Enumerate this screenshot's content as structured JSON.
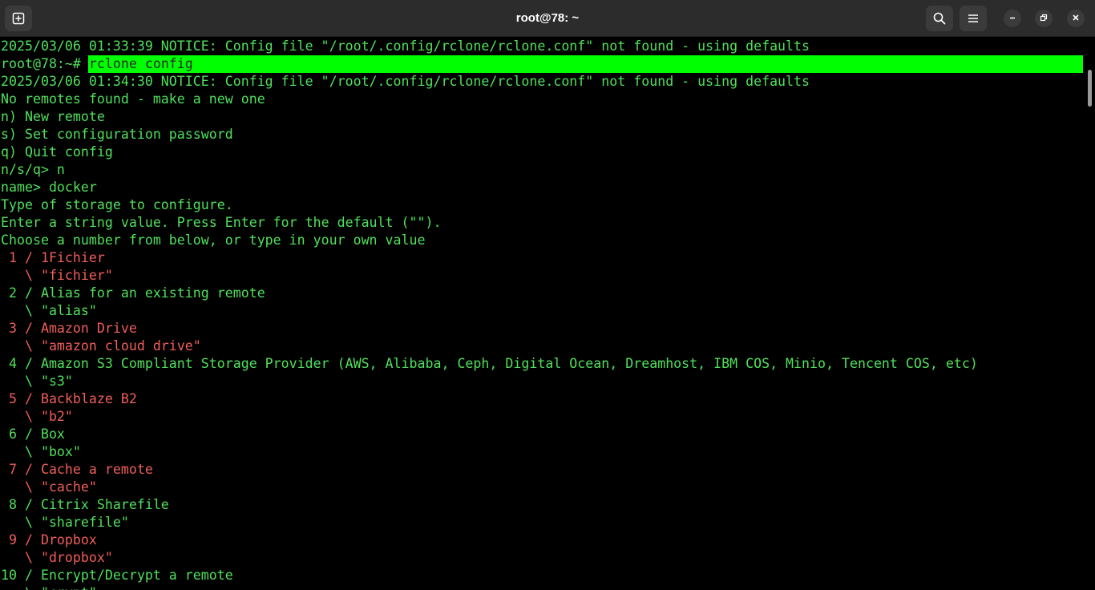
{
  "window": {
    "title": "root@78: ~"
  },
  "titlebar": {
    "new_tab_icon": "new-tab-icon",
    "search_icon": "search-icon",
    "menu_icon": "hamburger-menu-icon",
    "minimize_icon": "minimize-icon",
    "restore_icon": "restore-icon",
    "close_icon": "close-icon"
  },
  "terminal": {
    "prompt": "root@78:~# ",
    "command": "rclone config",
    "lines": [
      {
        "text": "2025/03/06 01:33:39 NOTICE: Config file \"/root/.config/rclone/rclone.conf\" not found - using defaults",
        "color": "green"
      },
      {
        "text": "__COMMAND__",
        "color": "green"
      },
      {
        "text": "2025/03/06 01:34:30 NOTICE: Config file \"/root/.config/rclone/rclone.conf\" not found - using defaults",
        "color": "green"
      },
      {
        "text": "No remotes found - make a new one",
        "color": "green"
      },
      {
        "text": "n) New remote",
        "color": "green"
      },
      {
        "text": "s) Set configuration password",
        "color": "green"
      },
      {
        "text": "q) Quit config",
        "color": "green"
      },
      {
        "text": "n/s/q> n",
        "color": "green"
      },
      {
        "text": "name> docker",
        "color": "green"
      },
      {
        "text": "Type of storage to configure.",
        "color": "green"
      },
      {
        "text": "Enter a string value. Press Enter for the default (\"\").",
        "color": "green"
      },
      {
        "text": "Choose a number from below, or type in your own value",
        "color": "green"
      },
      {
        "text": " 1 / 1Fichier",
        "color": "red"
      },
      {
        "text": "   \\ \"fichier\"",
        "color": "red"
      },
      {
        "text": " 2 / Alias for an existing remote",
        "color": "green"
      },
      {
        "text": "   \\ \"alias\"",
        "color": "green"
      },
      {
        "text": " 3 / Amazon Drive",
        "color": "red"
      },
      {
        "text": "   \\ \"amazon cloud drive\"",
        "color": "red"
      },
      {
        "text": " 4 / Amazon S3 Compliant Storage Provider (AWS, Alibaba, Ceph, Digital Ocean, Dreamhost, IBM COS, Minio, Tencent COS, etc)",
        "color": "green"
      },
      {
        "text": "   \\ \"s3\"",
        "color": "green"
      },
      {
        "text": " 5 / Backblaze B2",
        "color": "red"
      },
      {
        "text": "   \\ \"b2\"",
        "color": "red"
      },
      {
        "text": " 6 / Box",
        "color": "green"
      },
      {
        "text": "   \\ \"box\"",
        "color": "green"
      },
      {
        "text": " 7 / Cache a remote",
        "color": "red"
      },
      {
        "text": "   \\ \"cache\"",
        "color": "red"
      },
      {
        "text": " 8 / Citrix Sharefile",
        "color": "green"
      },
      {
        "text": "   \\ \"sharefile\"",
        "color": "green"
      },
      {
        "text": " 9 / Dropbox",
        "color": "red"
      },
      {
        "text": "   \\ \"dropbox\"",
        "color": "red"
      },
      {
        "text": "10 / Encrypt/Decrypt a remote",
        "color": "green"
      },
      {
        "text": "   \\ \"crypt\"",
        "color": "green"
      }
    ]
  },
  "colors": {
    "green": "#4fe05a",
    "red": "#ef5e5a",
    "highlight": "#00ff00",
    "titlebar": "#2c2c2c",
    "background": "#000000"
  }
}
